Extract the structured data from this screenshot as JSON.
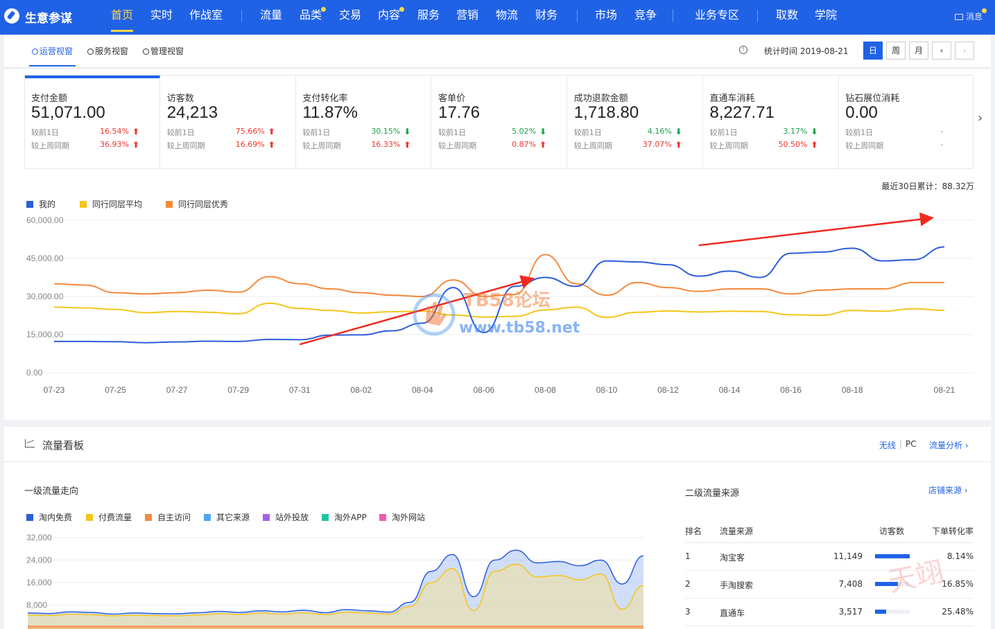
{
  "app": {
    "brand": "生意参谋",
    "message_label": "消息"
  },
  "nav": [
    {
      "label": "首页",
      "active": true
    },
    {
      "label": "实时"
    },
    {
      "label": "作战室"
    },
    {
      "label": "流量"
    },
    {
      "label": "品类",
      "dot": true
    },
    {
      "label": "交易"
    },
    {
      "label": "内容",
      "dot": true
    },
    {
      "label": "服务"
    },
    {
      "label": "营销"
    },
    {
      "label": "物流"
    },
    {
      "label": "财务"
    },
    {
      "label": "市场"
    },
    {
      "label": "竞争"
    },
    {
      "label": "业务专区"
    },
    {
      "label": "取数"
    },
    {
      "label": "学院"
    }
  ],
  "views": [
    {
      "label": "运营视窗",
      "active": true
    },
    {
      "label": "服务视窗"
    },
    {
      "label": "管理视窗"
    }
  ],
  "stat_time": "统计时间 2019-08-21",
  "period_buttons": [
    {
      "label": "日",
      "active": true
    },
    {
      "label": "周"
    },
    {
      "label": "月"
    },
    {
      "label": "‹"
    },
    {
      "label": "›"
    }
  ],
  "kpi_compare_labels": {
    "day": "较前1日",
    "week": "较上周同期"
  },
  "kpis": [
    {
      "label": "支付金额",
      "value": "51,071.00",
      "day": "16.54%",
      "day_dir": "up",
      "week": "36.93%",
      "week_dir": "up"
    },
    {
      "label": "访客数",
      "value": "24,213",
      "day": "75.66%",
      "day_dir": "up",
      "week": "16.69%",
      "week_dir": "up"
    },
    {
      "label": "支付转化率",
      "value": "11.87%",
      "day": "30.15%",
      "day_dir": "down",
      "week": "16.33%",
      "week_dir": "up"
    },
    {
      "label": "客单价",
      "value": "17.76",
      "day": "5.02%",
      "day_dir": "down",
      "week": "0.87%",
      "week_dir": "up"
    },
    {
      "label": "成功退款金额",
      "value": "1,718.80",
      "day": "4.16%",
      "day_dir": "down",
      "week": "37.07%",
      "week_dir": "up"
    },
    {
      "label": "直通车消耗",
      "value": "8,227.71",
      "day": "3.17%",
      "day_dir": "down",
      "week": "50.50%",
      "week_dir": "up"
    },
    {
      "label": "钻石展位消耗",
      "value": "0.00",
      "day": "-",
      "day_dir": "none",
      "week": "-",
      "week_dir": "none"
    }
  ],
  "total_30d": "最近30日累计：88.32万",
  "chart_data": [
    {
      "type": "line",
      "x": [
        "07-23",
        "07-24",
        "07-25",
        "07-26",
        "07-27",
        "07-28",
        "07-29",
        "07-30",
        "07-31",
        "08-01",
        "08-02",
        "08-03",
        "08-04",
        "08-05",
        "08-06",
        "08-07",
        "08-08",
        "08-09",
        "08-10",
        "08-11",
        "08-12",
        "08-13",
        "08-14",
        "08-15",
        "08-16",
        "08-17",
        "08-18",
        "08-19",
        "08-20",
        "08-21"
      ],
      "x_ticks": [
        "07-23",
        "07-25",
        "07-27",
        "07-29",
        "07-31",
        "08-02",
        "08-04",
        "08-06",
        "08-08",
        "08-10",
        "08-12",
        "08-14",
        "08-16",
        "08-18",
        "08-21"
      ],
      "y_ticks": [
        "60,000.00",
        "45,000.00",
        "30,000.00",
        "15,000.00",
        "0.00"
      ],
      "ylim": [
        0,
        60000
      ],
      "legend_position": "top-left",
      "grid": true,
      "series": [
        {
          "name": "我的",
          "color": "#2b5ed8",
          "values": [
            12300,
            12300,
            12200,
            11800,
            12100,
            12400,
            12300,
            13100,
            13000,
            14800,
            14900,
            16500,
            19500,
            33500,
            15800,
            34000,
            37500,
            34000,
            44000,
            43600,
            42500,
            38000,
            40000,
            37500,
            47000,
            47500,
            49000,
            44000,
            44500,
            49500
          ]
        },
        {
          "name": "同行同层平均",
          "color": "#f5c518",
          "values": [
            25800,
            25500,
            24900,
            23600,
            24100,
            23800,
            23200,
            27300,
            25300,
            24500,
            23500,
            24000,
            24200,
            22700,
            21900,
            22200,
            24700,
            25800,
            21800,
            23800,
            24300,
            23900,
            24200,
            24100,
            22800,
            22600,
            24500,
            24200,
            25200,
            24500
          ]
        },
        {
          "name": "同行同层优秀",
          "color": "#f58a3c",
          "values": [
            35000,
            34500,
            31500,
            31000,
            31500,
            32500,
            31700,
            37800,
            35000,
            33000,
            31500,
            30500,
            30000,
            36500,
            30000,
            30800,
            46500,
            35000,
            30500,
            35500,
            33500,
            32000,
            33000,
            33000,
            31000,
            32500,
            33000,
            33000,
            35500,
            35500
          ]
        }
      ]
    },
    {
      "type": "area",
      "title": "一级流量走向",
      "y_ticks": [
        "32,000",
        "24,000",
        "16,000",
        "8,000"
      ],
      "ylim": [
        0,
        32000
      ],
      "legend_position": "top-left",
      "grid": true,
      "series": [
        {
          "name": "淘内免费",
          "color": "#2b5ed8",
          "values": [
            5200,
            5000,
            5600,
            5400,
            4800,
            5200,
            5000,
            4900,
            5300,
            5800,
            5400,
            6000,
            5600,
            6200,
            5300,
            6400,
            6000,
            5500,
            9000,
            20000,
            26000,
            11000,
            24000,
            27500,
            23000,
            23500,
            22000,
            24000,
            15500,
            25500
          ]
        },
        {
          "name": "付费流量",
          "color": "#f5c518",
          "values": [
            4500,
            4300,
            4800,
            4600,
            4200,
            4400,
            4300,
            4200,
            4500,
            5000,
            4700,
            5200,
            4800,
            5300,
            4600,
            5500,
            5200,
            4800,
            7500,
            16000,
            21000,
            6000,
            20000,
            22500,
            18000,
            18500,
            17000,
            19000,
            6500,
            15000
          ]
        },
        {
          "name": "自主访问",
          "color": "#f58a3c",
          "values": [
            500,
            500,
            500,
            500,
            500,
            500,
            500,
            500,
            500,
            500,
            500,
            500,
            500,
            500,
            500,
            500,
            500,
            500,
            500,
            500,
            500,
            500,
            500,
            500,
            500,
            500,
            500,
            500,
            500,
            500
          ]
        },
        {
          "name": "其它来源",
          "color": "#4ea6f5",
          "values": []
        },
        {
          "name": "站外投放",
          "color": "#a65ff0",
          "values": []
        },
        {
          "name": "淘外APP",
          "color": "#1ec5a3",
          "values": []
        },
        {
          "name": "淘外网站",
          "color": "#f25ab2",
          "values": []
        }
      ]
    }
  ],
  "board": {
    "title": "流量看板",
    "links": [
      "无线",
      "PC",
      "流量分析 ›"
    ],
    "first_level_title": "一级流量走向",
    "second_level_title": "二级流量来源",
    "shop_source_link": "店铺来源 ›",
    "table_headers": [
      "排名",
      "流量来源",
      "访客数",
      "下单转化率"
    ],
    "rows": [
      {
        "rank": "1",
        "source": "淘宝客",
        "visitors": "11,149",
        "bar": 1.0,
        "cvr": "8.14%"
      },
      {
        "rank": "2",
        "source": "手淘搜索",
        "visitors": "7,408",
        "bar": 0.66,
        "cvr": "16.85%"
      },
      {
        "rank": "3",
        "source": "直通车",
        "visitors": "3,517",
        "bar": 0.32,
        "cvr": "25.48%"
      }
    ]
  },
  "watermark": {
    "text_main": "TB58论坛",
    "text_url": "www.tb58.net",
    "text_corner": "天翊"
  }
}
